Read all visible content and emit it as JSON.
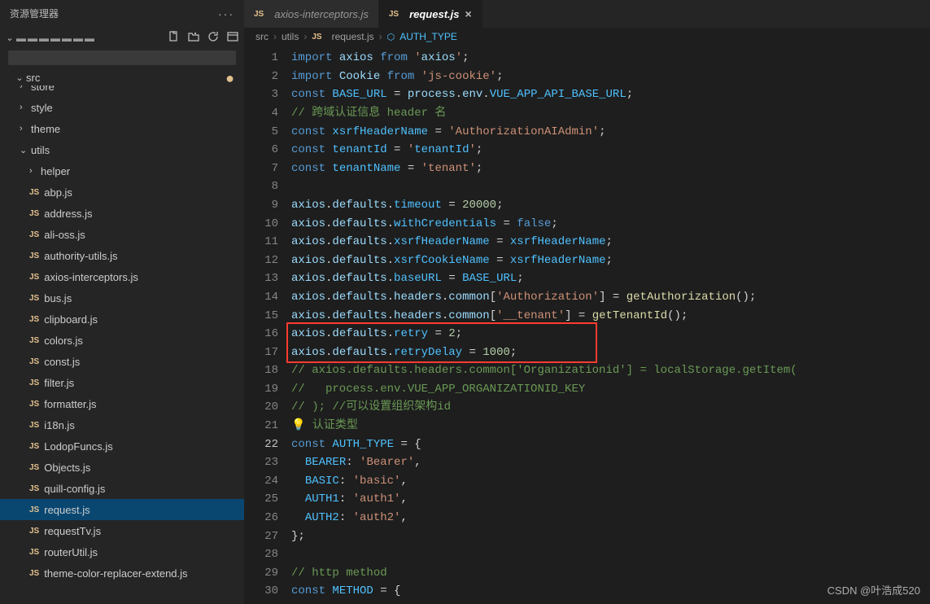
{
  "sidebar": {
    "title": "资源管理器",
    "root": "src",
    "folders": [
      "store",
      "style",
      "theme",
      "utils"
    ],
    "utilsOpen": true,
    "subfolders": [
      "helper"
    ],
    "files": [
      "abp.js",
      "address.js",
      "ali-oss.js",
      "authority-utils.js",
      "axios-interceptors.js",
      "bus.js",
      "clipboard.js",
      "colors.js",
      "const.js",
      "filter.js",
      "formatter.js",
      "i18n.js",
      "LodopFuncs.js",
      "Objects.js",
      "quill-config.js",
      "request.js",
      "requestTv.js",
      "routerUtil.js",
      "theme-color-replacer-extend.js"
    ],
    "selected": "request.js"
  },
  "tabs": [
    {
      "label": "axios-interceptors.js",
      "active": false
    },
    {
      "label": "request.js",
      "active": true
    }
  ],
  "breadcrumb": {
    "segments": [
      "src",
      "utils",
      "request.js"
    ],
    "symbol": "AUTH_TYPE"
  },
  "code": {
    "lines": [
      "import axios from 'axios';",
      "import Cookie from 'js-cookie';",
      "const BASE_URL = process.env.VUE_APP_API_BASE_URL;",
      "// 跨域认证信息 header 名",
      "const xsrfHeaderName = 'AuthorizationAIAdmin';",
      "const tenantId = 'tenantId';",
      "const tenantName = 'tenant';",
      "",
      "axios.defaults.timeout = 20000;",
      "axios.defaults.withCredentials = false;",
      "axios.defaults.xsrfHeaderName = xsrfHeaderName;",
      "axios.defaults.xsrfCookieName = xsrfHeaderName;",
      "axios.defaults.baseURL = BASE_URL;",
      "axios.defaults.headers.common['Authorization'] = getAuthorization();",
      "axios.defaults.headers.common['__tenant'] = getTenantId();",
      "axios.defaults.retry = 2;",
      "axios.defaults.retryDelay = 1000;",
      "// axios.defaults.headers.common['Organizationid'] = localStorage.getItem(",
      "//   process.env.VUE_APP_ORGANIZATIONID_KEY",
      "// ); //可以设置组织架构id",
      "💡 认证类型",
      "const AUTH_TYPE = {",
      "  BEARER: 'Bearer',",
      "  BASIC: 'basic',",
      "  AUTH1: 'auth1',",
      "  AUTH2: 'auth2',",
      "};",
      "",
      "// http method",
      "const METHOD = {"
    ],
    "currentLine": 22
  },
  "redbox": {
    "topLine": 16,
    "bottomLine": 17
  },
  "watermark": "CSDN @叶浩成520"
}
